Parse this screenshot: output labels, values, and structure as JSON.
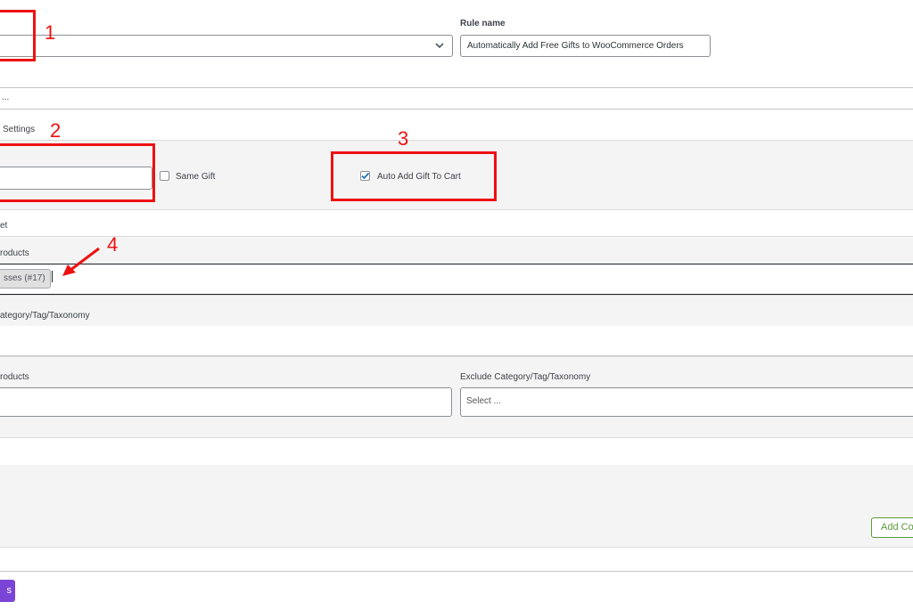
{
  "rule_name": {
    "label": "Rule name",
    "value": "Automatically Add Free Gifts to WooCommerce Orders"
  },
  "dropdown_row": {
    "text": "..."
  },
  "settings": {
    "section_label": "Settings",
    "same_gift_label": "Same Gift",
    "auto_add_label": "Auto Add Gift To Cart",
    "auto_add_checked": true
  },
  "target_label": "et",
  "products": {
    "label": "roducts",
    "selected_tag": "sses (#17)"
  },
  "category": {
    "label": "ategory/Tag/Taxonomy"
  },
  "exclude_products": {
    "label": "roducts"
  },
  "exclude_category": {
    "label": "Exclude Category/Tag/Taxonomy",
    "placeholder": "Select ..."
  },
  "add_condition_label": "Add Co",
  "save_label": "s",
  "annotations": [
    "1",
    "2",
    "3",
    "4"
  ],
  "colors": {
    "annotation": "#ee1111",
    "primary_button": "#7a45d6",
    "add_button": "#5b9a3c",
    "band": "#f4f4f4"
  }
}
